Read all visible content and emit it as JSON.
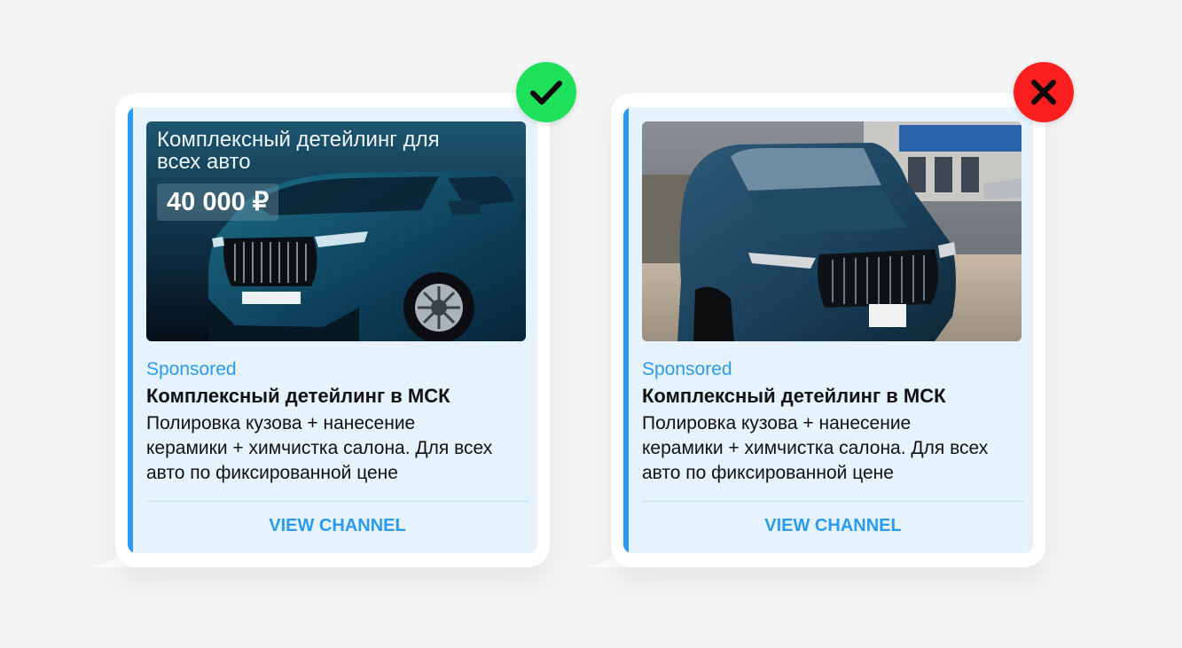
{
  "colors": {
    "background": "#f5f5f5",
    "ad_background": "#e6f2fc",
    "accent": "#2a9bf0",
    "good_badge": "#1fe05a",
    "bad_badge": "#fb1f1f"
  },
  "cards": [
    {
      "status": "good",
      "status_icon": "checkmark-icon",
      "media_type": "designed-banner",
      "banner_title": "Комплексный детейлинг для всех авто",
      "banner_price": "40 000 ₽",
      "sponsored": "Sponsored",
      "title": "Комплексный детейлинг в МСК",
      "description": "Полировка кузова + нанесение керамики + химчистка салона. Для всех авто по фиксированной цене",
      "cta": "VIEW CHANNEL"
    },
    {
      "status": "bad",
      "status_icon": "cross-icon",
      "media_type": "raw-photo",
      "sponsored": "Sponsored",
      "title": "Комплексный детейлинг в МСК",
      "description": "Полировка кузова + нанесение керамики + химчистка салона. Для всех авто по фиксированной цене",
      "cta": "VIEW CHANNEL"
    }
  ]
}
